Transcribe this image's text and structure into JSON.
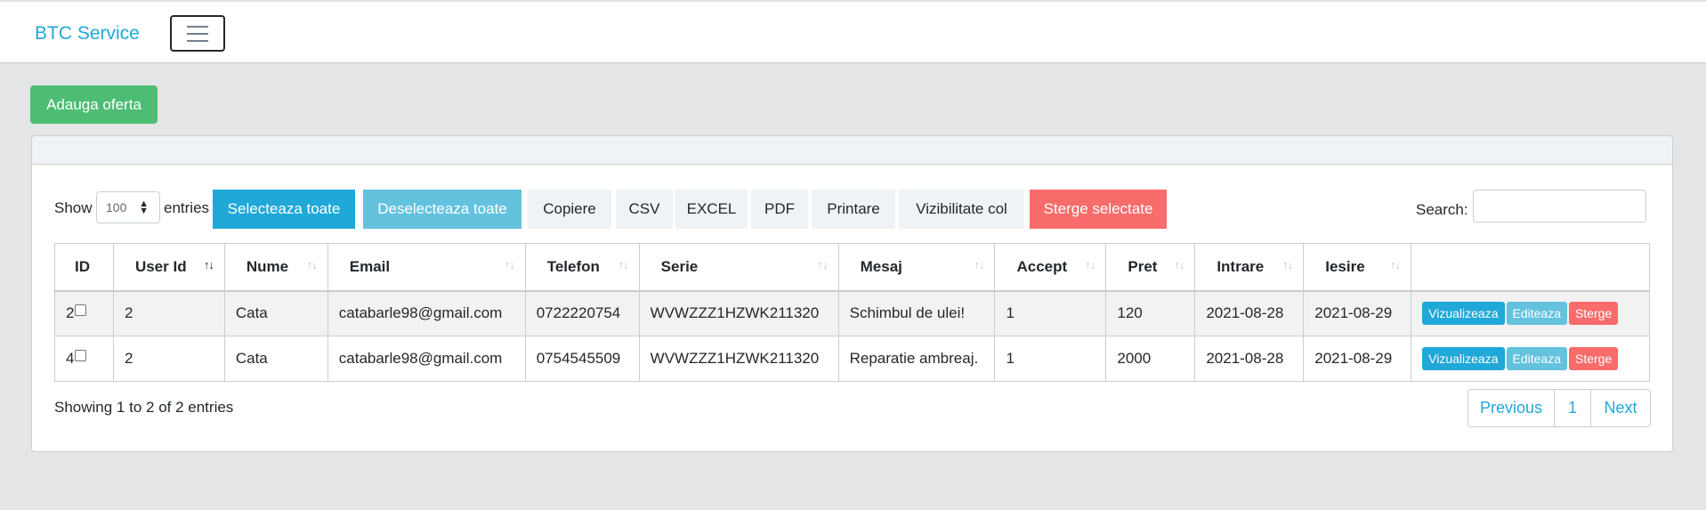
{
  "navbar": {
    "brand": "BTC Service"
  },
  "actions": {
    "add_offer": "Adauga oferta"
  },
  "toolbar": {
    "show": "Show",
    "entries_value": "100",
    "entries": "entries",
    "select_all": "Selecteaza toate",
    "deselect_all": "Deselecteaza toate",
    "copy": "Copiere",
    "csv": "CSV",
    "excel": "EXCEL",
    "pdf": "PDF",
    "print": "Printare",
    "col_visibility": "Vizibilitate col",
    "delete_selected": "Sterge selectate",
    "search_label": "Search:"
  },
  "table": {
    "headers": [
      "ID",
      "User Id",
      "Nume",
      "Email",
      "Telefon",
      "Serie",
      "Mesaj",
      "Accept",
      "Pret",
      "Intrare",
      "Iesire",
      ""
    ],
    "rows": [
      {
        "id": "2",
        "user_id": "2",
        "nume": "Cata",
        "email": "catabarle98@gmail.com",
        "telefon": "0722220754",
        "serie": "WVWZZZ1HZWK211320",
        "mesaj": "Schimbul de ulei!",
        "accept": "1",
        "pret": "120",
        "intrare": "2021-08-28",
        "iesire": "2021-08-29"
      },
      {
        "id": "4",
        "user_id": "2",
        "nume": "Cata",
        "email": "catabarle98@gmail.com",
        "telefon": "0754545509",
        "serie": "WVWZZZ1HZWK211320",
        "mesaj": "Reparatie ambreaj.",
        "accept": "1",
        "pret": "2000",
        "intrare": "2021-08-28",
        "iesire": "2021-08-29"
      }
    ],
    "row_actions": {
      "view": "Vizualizeaza",
      "edit": "Editeaza",
      "delete": "Sterge"
    }
  },
  "footer": {
    "info": "Showing 1 to 2 of 2 entries",
    "previous": "Previous",
    "page": "1",
    "next": "Next"
  },
  "colors": {
    "primary": "#20a8d8",
    "info": "#63c2de",
    "success": "#4dbd74",
    "danger": "#f86c6b"
  }
}
